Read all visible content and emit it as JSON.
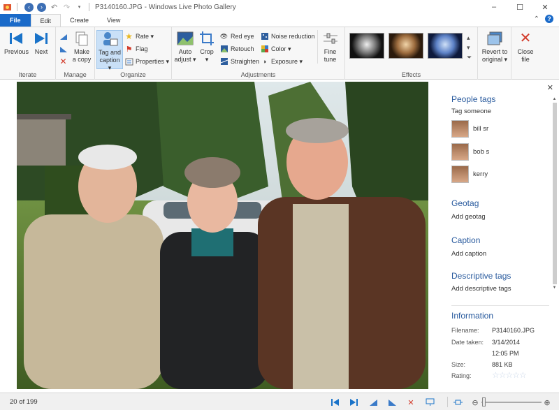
{
  "window": {
    "title": "P3140160.JPG - Windows Live Photo Gallery",
    "controls": {
      "minimize": "–",
      "maximize": "☐",
      "close": "✕"
    }
  },
  "ribbon": {
    "tabs": [
      {
        "label": "File",
        "active": false
      },
      {
        "label": "Edit",
        "active": true
      },
      {
        "label": "Create",
        "active": false
      },
      {
        "label": "View",
        "active": false
      }
    ],
    "groups": {
      "iterate": {
        "label": "Iterate",
        "previous": "Previous",
        "next": "Next"
      },
      "manage": {
        "label": "Manage",
        "make_copy_1": "Make",
        "make_copy_2": "a copy"
      },
      "organize": {
        "label": "Organize",
        "tag_caption_1": "Tag and",
        "tag_caption_2": "caption ▾",
        "rate": "Rate ▾",
        "flag": "Flag",
        "properties": "Properties ▾"
      },
      "adjustments": {
        "label": "Adjustments",
        "auto_adjust_1": "Auto",
        "auto_adjust_2": "adjust ▾",
        "crop_1": "Crop",
        "crop_2": "▾",
        "red_eye": "Red eye",
        "retouch": "Retouch",
        "straighten": "Straighten",
        "noise_reduction": "Noise reduction",
        "color": "Color ▾",
        "exposure": "Exposure ▾",
        "fine_tune_1": "Fine",
        "fine_tune_2": "tune"
      },
      "effects": {
        "label": "Effects"
      },
      "revert": {
        "line1": "Revert to",
        "line2": "original ▾"
      },
      "close": {
        "line1": "Close",
        "line2": "file"
      }
    }
  },
  "pane": {
    "people_header": "People tags",
    "tag_someone": "Tag someone",
    "people": [
      "bill sr",
      "bob s",
      "kerry"
    ],
    "geotag_header": "Geotag",
    "add_geotag": "Add geotag",
    "caption_header": "Caption",
    "add_caption": "Add caption",
    "desc_header": "Descriptive tags",
    "add_desc": "Add descriptive tags",
    "info_header": "Information",
    "info": {
      "filename_label": "Filename:",
      "filename": "P3140160.JPG",
      "date_label": "Date taken:",
      "date": "3/14/2014",
      "time": "12:05 PM",
      "size_label": "Size:",
      "size": "881 KB",
      "rating_label": "Rating:",
      "rating": 0
    }
  },
  "status": {
    "count": "20 of 199"
  },
  "colors": {
    "accent": "#1a6ac9",
    "link": "#2a5b9e"
  }
}
